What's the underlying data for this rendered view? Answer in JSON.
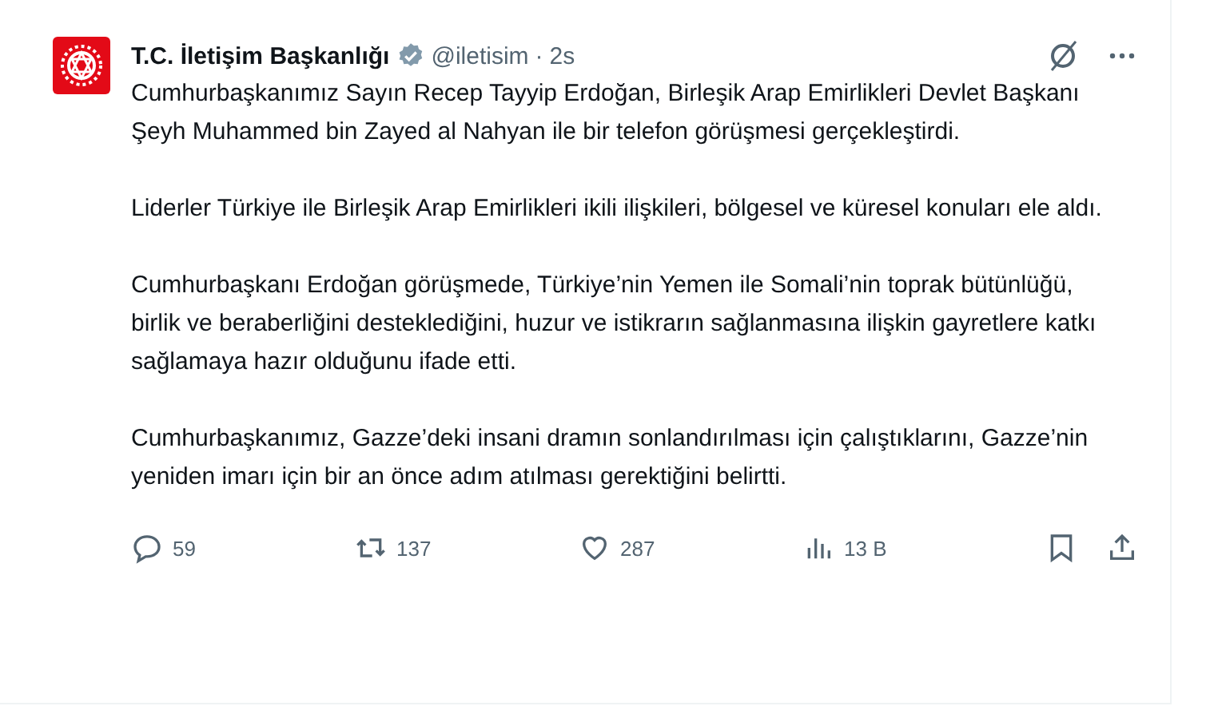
{
  "post": {
    "author": "T.C. İletişim Başkanlığı",
    "verified": true,
    "handle": "@iletisim",
    "separator": "·",
    "time": "2s",
    "paragraphs": [
      "Cumhurbaşkanımız Sayın Recep Tayyip Erdoğan, Birleşik Arap Emirlikleri Devlet Başkanı Şeyh Muhammed bin Zayed al Nahyan ile bir telefon görüşmesi gerçekleştirdi.",
      "Liderler Türkiye ile Birleşik Arap Emirlikleri ikili ilişkileri, bölgesel ve küresel konuları ele aldı.",
      "Cumhurbaşkanı Erdoğan görüşmede, Türkiye’nin Yemen ile Somali’nin toprak bütünlüğü, birlik ve beraberliğini desteklediğini, huzur ve istikrarın sağlanmasına ilişkin gayretlere katkı sağlamaya hazır olduğunu ifade etti.",
      "Cumhurbaşkanımız, Gazze’deki insani dramın sonlandırılması için çalıştıklarını, Gazze’nin yeniden imarı için bir an önce adım atılması gerektiğini belirtti."
    ],
    "actions": [
      {
        "kind": "reply",
        "count": "59"
      },
      {
        "kind": "repost",
        "count": "137"
      },
      {
        "kind": "like",
        "count": "287"
      },
      {
        "kind": "views",
        "count": "13 B"
      }
    ]
  }
}
